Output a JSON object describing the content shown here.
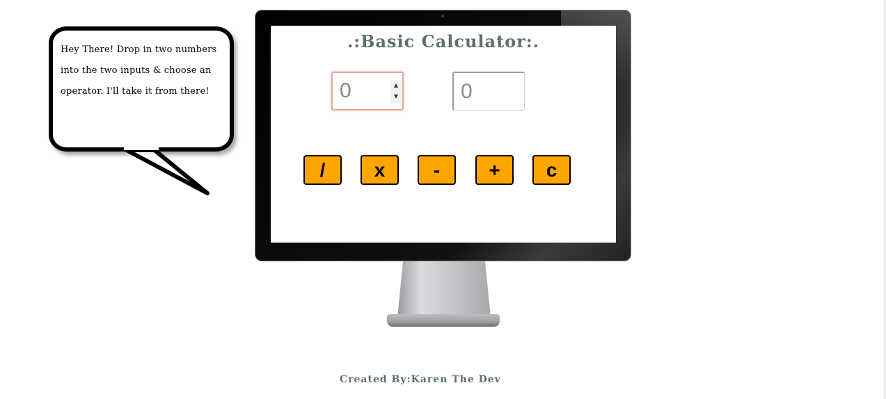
{
  "speech_bubble": {
    "text": "Hey There! Drop in two numbers into the two inputs & choose an operator. I'll take it from there!"
  },
  "calculator": {
    "title": ".:Basic Calculator:.",
    "input_one": {
      "value": "",
      "placeholder": "0"
    },
    "input_two": {
      "value": "",
      "placeholder": "0"
    },
    "spinner_up": "▲",
    "spinner_down": "▼",
    "operators": {
      "divide": "/",
      "multiply": "x",
      "subtract": "-",
      "add": "+",
      "clear": "c"
    },
    "button_color": "#ffa500",
    "title_color": "#5a716b"
  },
  "footer": {
    "credit": "Created By:Karen The Dev"
  }
}
